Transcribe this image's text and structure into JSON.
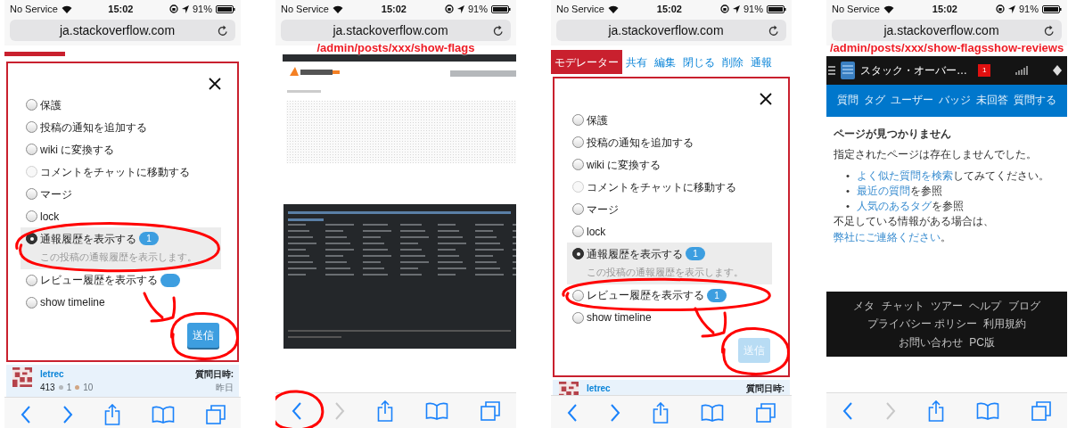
{
  "phones": [
    {
      "kind": "flag-dialog",
      "status_bar": {
        "carrier": "No Service",
        "time": "15:02",
        "battery": "91%"
      },
      "url": "ja.stackoverflow.com",
      "header": {
        "kind": "red-strip"
      },
      "dialog": {
        "arrow": true,
        "options": [
          {
            "label": "保護",
            "disabled": false,
            "selected": false
          },
          {
            "label": "投稿の通知を追加する",
            "disabled": false,
            "selected": false
          },
          {
            "label": "wiki に変換する",
            "disabled": false,
            "selected": false
          },
          {
            "label": "コメントをチャットに移動する",
            "disabled": true,
            "selected": false
          },
          {
            "label": "マージ",
            "disabled": false,
            "selected": false
          },
          {
            "label": "lock",
            "disabled": false,
            "selected": false
          },
          {
            "label": "通報履歴を表示する",
            "disabled": false,
            "selected": true,
            "badge": {
              "text": "1"
            },
            "description": "この投稿の通報履歴を表示します。",
            "circled": true
          },
          {
            "label": "レビュー履歴を表示する",
            "disabled": false,
            "selected": false,
            "badge": {
              "covered": true
            }
          },
          {
            "label": "show timeline",
            "disabled": false,
            "selected": false
          }
        ],
        "submit": {
          "label": "送信",
          "disabled": false,
          "circled": true
        }
      },
      "user_card": {
        "name": "letrec",
        "reputation": "413",
        "silver": "1",
        "bronze": "10",
        "asked_label": "質問日時:",
        "asked": "昨日"
      },
      "toolbar": [
        {
          "kind": "back",
          "disabled": false,
          "circled": false
        },
        {
          "kind": "forward",
          "disabled": false,
          "circled": false
        },
        {
          "kind": "share",
          "disabled": false,
          "circled": false
        },
        {
          "kind": "bookmarks",
          "disabled": false,
          "circled": false
        },
        {
          "kind": "tabs",
          "disabled": false,
          "circled": false
        }
      ]
    },
    {
      "kind": "flag-history",
      "status_bar": {
        "carrier": "No Service",
        "time": "15:02",
        "battery": "91%"
      },
      "url": "ja.stackoverflow.com",
      "url_note": "/admin/posts/xxx/show-flags",
      "toolbar": [
        {
          "kind": "back",
          "disabled": false,
          "circled": true
        },
        {
          "kind": "forward",
          "disabled": true,
          "circled": false
        },
        {
          "kind": "share",
          "disabled": false,
          "circled": false
        },
        {
          "kind": "bookmarks",
          "disabled": false,
          "circled": false
        },
        {
          "kind": "tabs",
          "disabled": false,
          "circled": false
        }
      ]
    },
    {
      "kind": "flag-dialog",
      "status_bar": {
        "carrier": "No Service",
        "time": "15:02",
        "battery": "91%"
      },
      "url": "ja.stackoverflow.com",
      "header": {
        "kind": "mod-tabs",
        "tabs": [
          {
            "label": "モデレーター",
            "selected": true
          },
          {
            "label": "共有",
            "selected": false
          },
          {
            "label": "編集",
            "selected": false
          },
          {
            "label": "閉じる",
            "selected": false
          },
          {
            "label": "削除",
            "selected": false
          },
          {
            "label": "通報",
            "selected": false
          }
        ]
      },
      "dialog": {
        "arrow": true,
        "options": [
          {
            "label": "保護",
            "disabled": false,
            "selected": false
          },
          {
            "label": "投稿の通知を追加する",
            "disabled": false,
            "selected": false
          },
          {
            "label": "wiki に変換する",
            "disabled": false,
            "selected": false
          },
          {
            "label": "コメントをチャットに移動する",
            "disabled": true,
            "selected": false
          },
          {
            "label": "マージ",
            "disabled": false,
            "selected": false
          },
          {
            "label": "lock",
            "disabled": false,
            "selected": false
          },
          {
            "label": "通報履歴を表示する",
            "disabled": false,
            "selected": true,
            "badge": {
              "text": "1"
            },
            "description": "この投稿の通報履歴を表示します。"
          },
          {
            "label": "レビュー履歴を表示する",
            "disabled": false,
            "selected": false,
            "badge": {
              "text": "1"
            },
            "circled": true
          },
          {
            "label": "show timeline",
            "disabled": false,
            "selected": false
          }
        ],
        "submit": {
          "label": "送信",
          "disabled": true,
          "circled": true
        }
      },
      "user_card": {
        "name": "letrec",
        "asked_label": "質問日時:"
      },
      "toolbar": [
        {
          "kind": "back",
          "disabled": false,
          "circled": false
        },
        {
          "kind": "forward",
          "disabled": false,
          "circled": false
        },
        {
          "kind": "share",
          "disabled": false,
          "circled": false
        },
        {
          "kind": "bookmarks",
          "disabled": false,
          "circled": false
        },
        {
          "kind": "tabs",
          "disabled": false,
          "circled": false
        }
      ]
    },
    {
      "kind": "not-found",
      "status_bar": {
        "carrier": "No Service",
        "time": "15:02",
        "battery": "91%"
      },
      "url": "ja.stackoverflow.com",
      "url_note": "/admin/posts/xxx/show-flagsshow-reviews",
      "site_header": {
        "title": "スタック・オーバー…",
        "inbox_count": "1"
      },
      "nav": [
        "質問",
        "タグ",
        "ユーザー",
        "バッジ",
        "未回答",
        "質問する"
      ],
      "heading": "ページが見つかりません",
      "message": "指定されたページは存在しませんでした。",
      "suggestions": [
        {
          "marker": "•",
          "link": "よく似た質問を検索",
          "text": "してみてください。"
        },
        {
          "marker": "•",
          "link": "最近の質問",
          "text": "を参照"
        },
        {
          "marker": "•",
          "link": "人気のあるタグ",
          "text": "を参照"
        }
      ],
      "contact": {
        "text": "不足している情報がある場合は、",
        "link": "弊社にご連絡ください",
        "end": "。"
      },
      "footer_links": [
        "メタ",
        "チャット",
        "ツアー",
        "ヘルプ",
        "ブログ",
        "プライバシー ポリシー",
        "利用規約",
        "お問い合わせ",
        "PC版"
      ],
      "toolbar": [
        {
          "kind": "back",
          "disabled": false,
          "circled": false
        },
        {
          "kind": "forward",
          "disabled": true,
          "circled": false
        },
        {
          "kind": "share",
          "disabled": false,
          "circled": false
        },
        {
          "kind": "bookmarks",
          "disabled": false,
          "circled": false
        },
        {
          "kind": "tabs",
          "disabled": false,
          "circled": false
        }
      ]
    }
  ]
}
